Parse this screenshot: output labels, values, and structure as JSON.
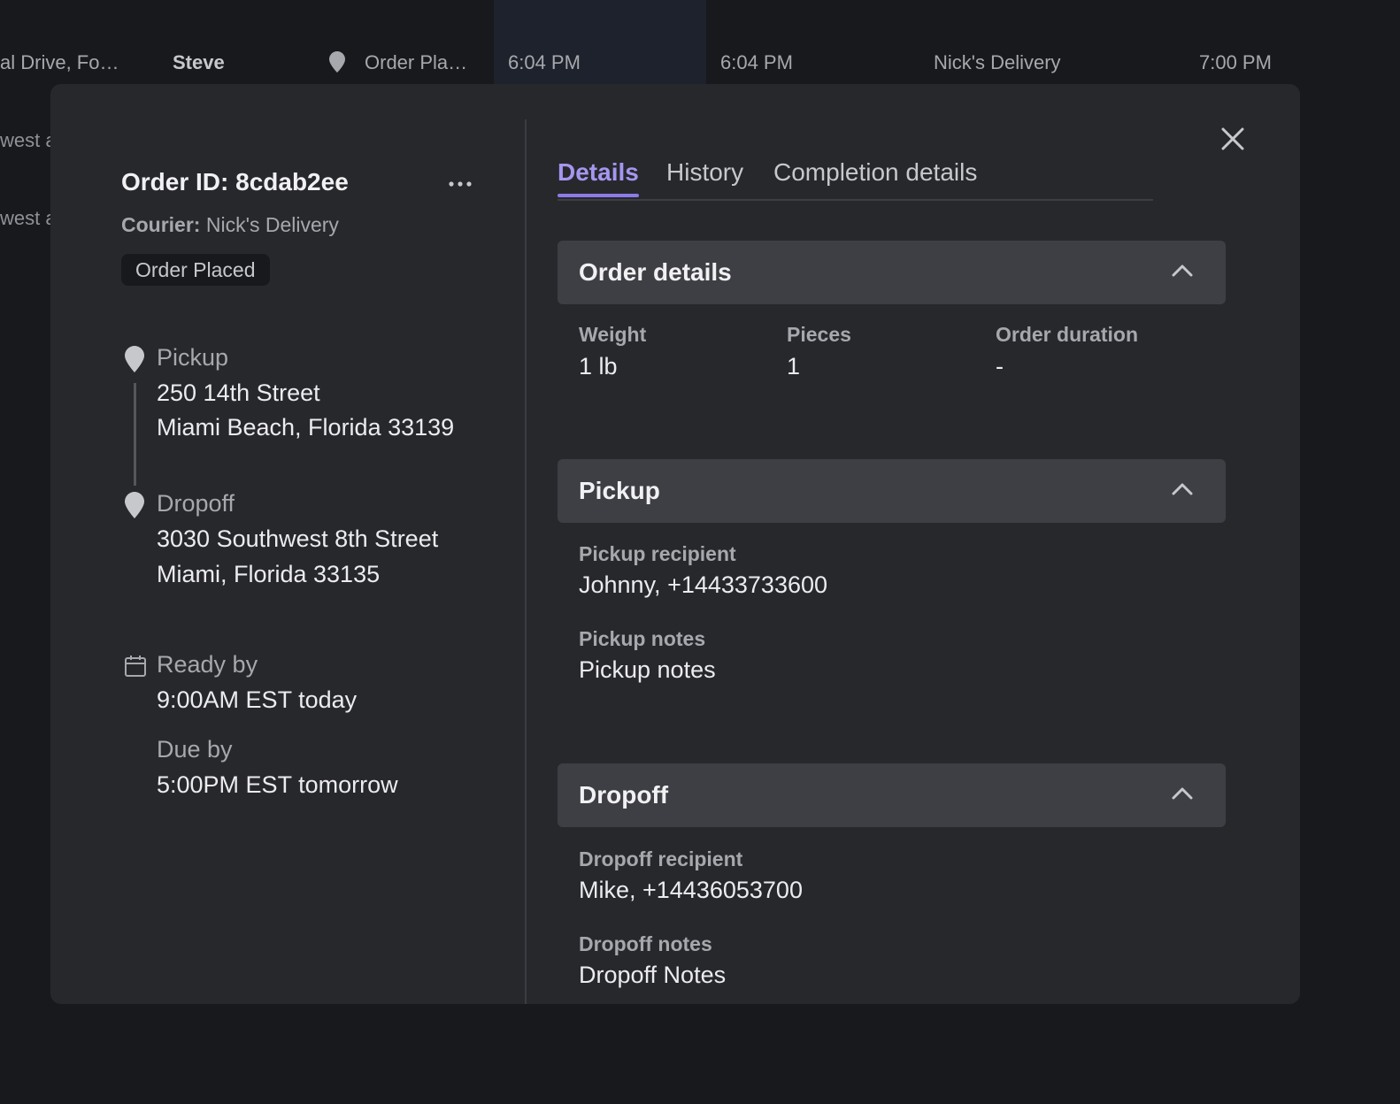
{
  "background_row": {
    "cells": [
      "al Drive, Fo…",
      "Steve",
      "Order Pla…",
      "6:04 PM",
      "6:04 PM",
      "Nick's Delivery",
      "7:00 PM"
    ],
    "side_rows": [
      "west a",
      "west a"
    ]
  },
  "order": {
    "id_label": "Order ID: 8cdab2ee",
    "more_label": "•••",
    "courier_label": "Courier:",
    "courier_name": "Nick's Delivery",
    "status": "Order Placed"
  },
  "pickup": {
    "label": "Pickup",
    "line1": "250 14th Street",
    "line2": "Miami Beach, Florida 33139"
  },
  "dropoff": {
    "label": "Dropoff",
    "line1": "3030 Southwest 8th Street",
    "line2": "Miami, Florida 33135"
  },
  "schedule": {
    "ready_label": "Ready by",
    "ready_value": "9:00AM EST today",
    "due_label": "Due by",
    "due_value": "5:00PM EST tomorrow"
  },
  "tabs": [
    {
      "label": "Details",
      "active": true
    },
    {
      "label": "History",
      "active": false
    },
    {
      "label": "Completion details",
      "active": false
    }
  ],
  "sections": {
    "order_details": {
      "title": "Order details",
      "fields": [
        {
          "label": "Weight",
          "value": "1 lb"
        },
        {
          "label": "Pieces",
          "value": "1"
        },
        {
          "label": "Order duration",
          "value": "-"
        }
      ]
    },
    "pickup": {
      "title": "Pickup",
      "recipient_label": "Pickup recipient",
      "recipient_value": "Johnny, +14433733600",
      "notes_label": "Pickup notes",
      "notes_value": "Pickup notes"
    },
    "dropoff": {
      "title": "Dropoff",
      "recipient_label": "Dropoff recipient",
      "recipient_value": "Mike, +14436053700",
      "notes_label": "Dropoff notes",
      "notes_value": "Dropoff Notes"
    }
  },
  "colors": {
    "accent": "#a596f0",
    "modal_bg": "#27282c",
    "page_bg": "#17191d",
    "section_header_bg": "#3e3f44"
  }
}
